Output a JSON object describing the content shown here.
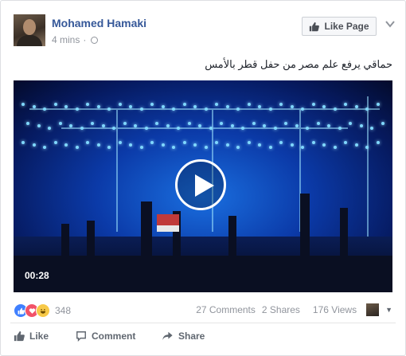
{
  "post": {
    "author": "Mohamed Hamaki",
    "time": "4 mins",
    "like_page_label": "Like Page",
    "text": "حماقي يرفع علم مصر من حفل قطر بالأمس"
  },
  "video": {
    "duration": "00:28"
  },
  "stats": {
    "reaction_count": "348",
    "comments": "27 Comments",
    "shares": "2 Shares",
    "views": "176 Views",
    "reactions": [
      "like-icon",
      "love-icon",
      "haha-icon"
    ]
  },
  "actions": {
    "like": "Like",
    "comment": "Comment",
    "share": "Share"
  },
  "colors": {
    "link": "#365899",
    "secondary_text": "#90949c",
    "border": "#dddfe2"
  }
}
